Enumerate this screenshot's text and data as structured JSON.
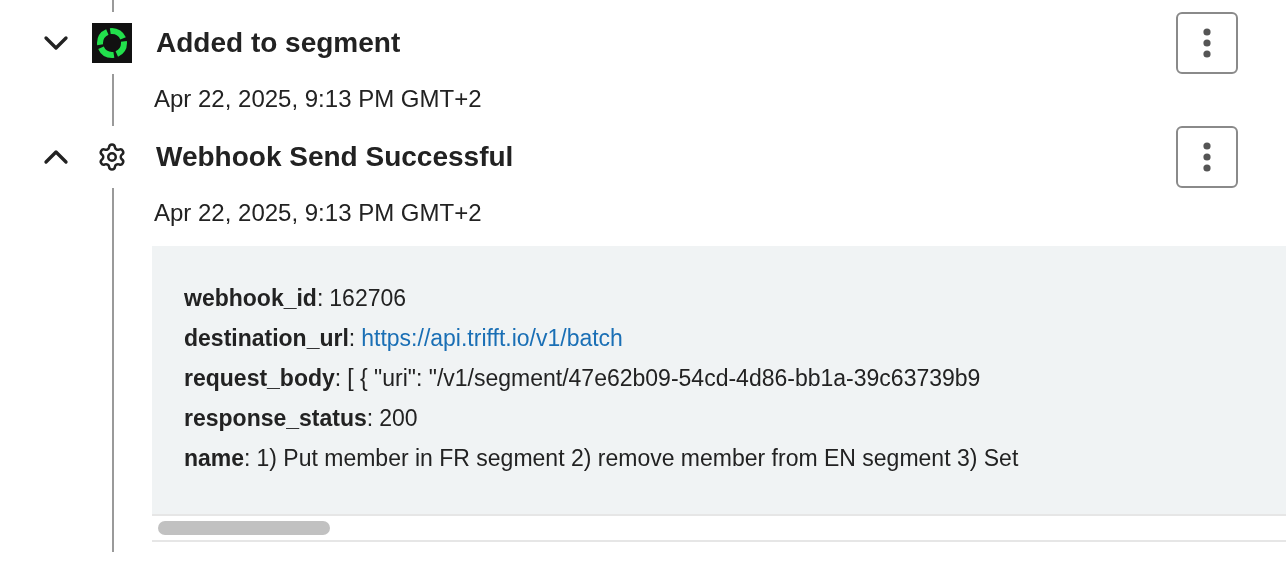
{
  "events": [
    {
      "title": "Added to segment",
      "timestamp": "Apr 22, 2025, 9:13 PM GMT+2",
      "kind": "segment",
      "expanded": false
    },
    {
      "title": "Webhook Send Successful",
      "timestamp": "Apr 22, 2025, 9:13 PM GMT+2",
      "kind": "gear",
      "expanded": true,
      "details": [
        {
          "key": "**webhook_id**:",
          "value": "162706",
          "kind": "text"
        },
        {
          "key": "**destination_url**:",
          "value": "https://api.trifft.io/v1/batch",
          "kind": "link"
        },
        {
          "key": "**request_body**:",
          "value": "[ { \"uri\": \"/v1/segment/47e62b09-54cd-4d86-bb1a-39c63739b9",
          "kind": "text"
        },
        {
          "key": "**response_status**:",
          "value": "200",
          "kind": "text"
        },
        {
          "key": "**name**:",
          "value": "1) Put member in FR segment 2) remove member from EN segment 3) Set",
          "kind": "text"
        }
      ]
    }
  ]
}
